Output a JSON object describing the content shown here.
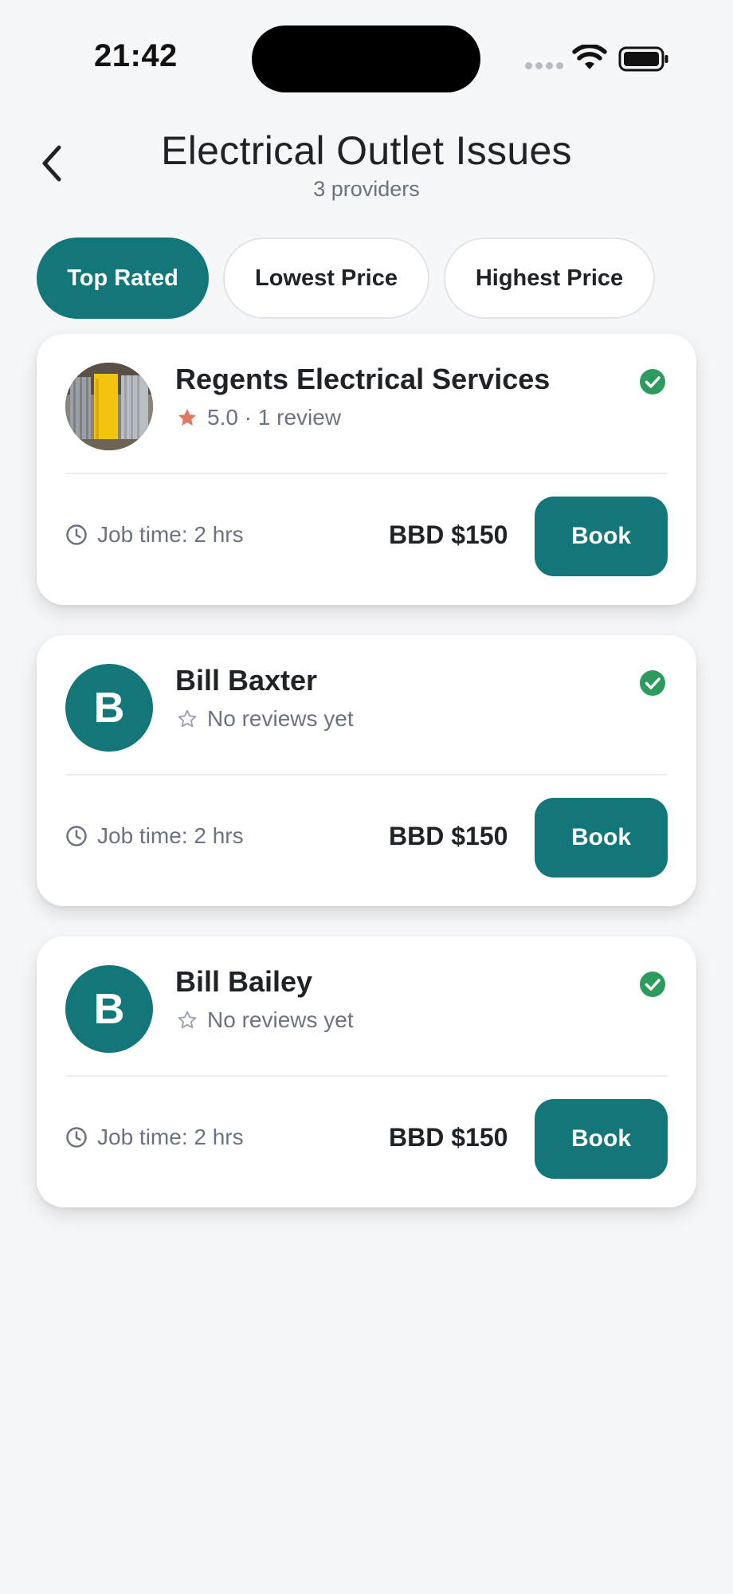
{
  "status_bar": {
    "time": "21:42"
  },
  "header": {
    "title": "Electrical Outlet Issues",
    "subtitle": "3 providers"
  },
  "filters": [
    {
      "label": "Top Rated",
      "active": true
    },
    {
      "label": "Lowest Price",
      "active": false
    },
    {
      "label": "Highest Price",
      "active": false
    }
  ],
  "providers": [
    {
      "name": "Regents Electrical Services",
      "avatar": "photo",
      "rating_text": "5.0 · 1 review",
      "rated": true,
      "verified": true,
      "job_time": "Job time: 2 hrs",
      "price": "BBD $150",
      "book_label": "Book"
    },
    {
      "name": "Bill Baxter",
      "avatar_initial": "B",
      "rating_text": "No reviews yet",
      "rated": false,
      "verified": true,
      "job_time": "Job time: 2 hrs",
      "price": "BBD $150",
      "book_label": "Book"
    },
    {
      "name": "Bill Bailey",
      "avatar_initial": "B",
      "rating_text": "No reviews yet",
      "rated": false,
      "verified": true,
      "job_time": "Job time: 2 hrs",
      "price": "BBD $150",
      "book_label": "Book"
    }
  ],
  "colors": {
    "accent": "#13777a",
    "verified": "#2e9b5e",
    "star": "#e07a5f"
  }
}
